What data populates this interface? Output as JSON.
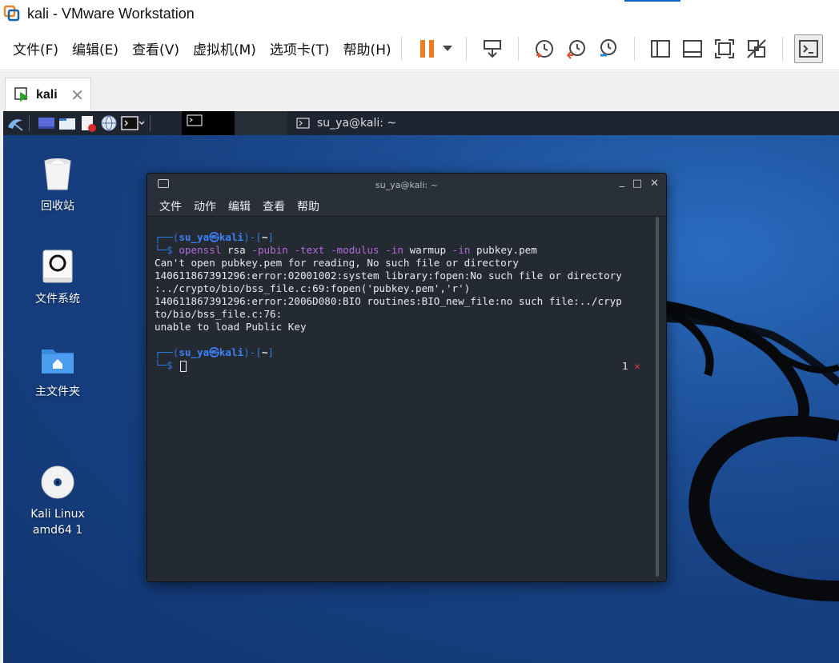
{
  "window": {
    "title": "kali - VMware Workstation"
  },
  "menu": [
    {
      "label": "文件(F)"
    },
    {
      "label": "编辑(E)"
    },
    {
      "label": "查看(V)"
    },
    {
      "label": "虚拟机(M)"
    },
    {
      "label": "选项卡(T)"
    },
    {
      "label": "帮助(H)"
    }
  ],
  "toolbar": {
    "icons": [
      "pause-icon",
      "dropdown-icon",
      "send-ctrl-alt-del-icon",
      "snapshot-icon",
      "revert-snapshot-icon",
      "snapshot-manager-icon",
      "sidebar-icon",
      "fullscreen-bar-icon",
      "fullscreen-icon",
      "unity-icon",
      "console-view-icon"
    ]
  },
  "tab": {
    "label": "kali"
  },
  "panel": {
    "window_title": "su_ya@kali: ~"
  },
  "desktop_icons": [
    {
      "label": "回收站"
    },
    {
      "label": "文件系统"
    },
    {
      "label": "主文件夹"
    },
    {
      "label": "Kali Linux\namd64 1"
    }
  ],
  "terminal": {
    "title": "su_ya@kali: ~",
    "menu": [
      "文件",
      "动作",
      "编辑",
      "查看",
      "帮助"
    ],
    "prompt_user": "su_ya㉿kali",
    "prompt_dir": "~",
    "command": {
      "cmd": "openssl",
      "args": [
        "rsa",
        "-pubin",
        "-text",
        "-modulus",
        "-in",
        "warmup",
        "-in",
        "pubkey.pem"
      ]
    },
    "output": [
      "Can't open pubkey.pem for reading, No such file or directory",
      "140611867391296:error:02001002:system library:fopen:No such file or directory",
      ":../crypto/bio/bss_file.c:69:fopen('pubkey.pem','r')",
      "140611867391296:error:2006D080:BIO routines:BIO_new_file:no such file:../cryp",
      "to/bio/bss_file.c:76:",
      "unable to load Public Key"
    ],
    "exit_status": "1",
    "exit_mark": "✕"
  }
}
